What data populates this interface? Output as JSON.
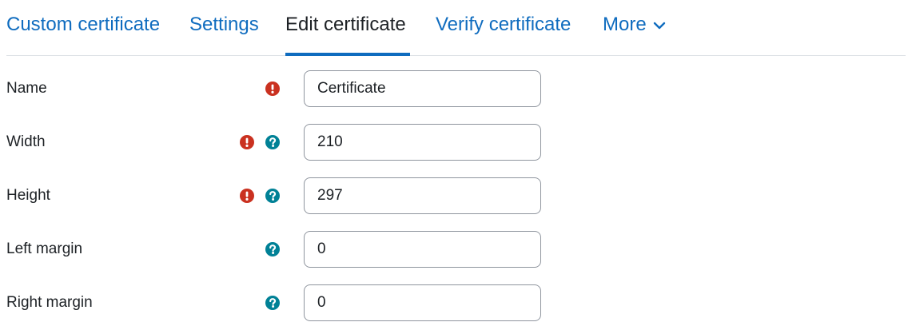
{
  "tabs": [
    {
      "label": "Custom certificate",
      "active": false
    },
    {
      "label": "Settings",
      "active": false
    },
    {
      "label": "Edit certificate",
      "active": true
    },
    {
      "label": "Verify certificate",
      "active": false
    },
    {
      "label": "More",
      "active": false
    }
  ],
  "colors": {
    "link": "#0f6cbf",
    "required": "#ca3120",
    "help": "#008196",
    "text": "#1d2125",
    "border": "#8f959e"
  },
  "form": {
    "fields": [
      {
        "label": "Name",
        "value": "Certificate",
        "required": true,
        "help": false
      },
      {
        "label": "Width",
        "value": "210",
        "required": true,
        "help": true
      },
      {
        "label": "Height",
        "value": "297",
        "required": true,
        "help": true
      },
      {
        "label": "Left margin",
        "value": "0",
        "required": false,
        "help": true
      },
      {
        "label": "Right margin",
        "value": "0",
        "required": false,
        "help": true
      }
    ]
  },
  "icons": {
    "required": "exclamation-circle-icon",
    "help": "question-circle-icon",
    "more": "chevron-down-icon"
  }
}
